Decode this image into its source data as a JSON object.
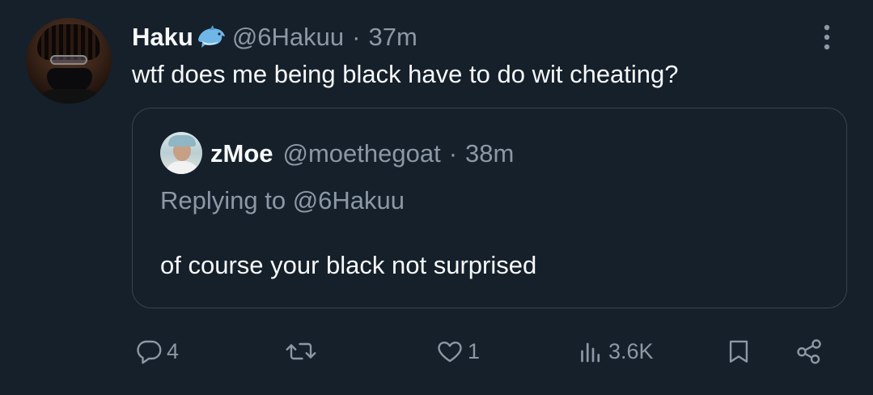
{
  "tweet": {
    "author_name": "Haku",
    "author_handle": "@6Hakuu",
    "separator": "·",
    "time": "37m",
    "text": "wtf does me being black have to do wit cheating?"
  },
  "quote": {
    "author_name": "zMoe",
    "author_handle": "@moethegoat",
    "separator": "·",
    "time": "38m",
    "replying_to": "Replying to @6Hakuu",
    "text": "of course your black not surprised"
  },
  "actions": {
    "replies": "4",
    "retweets": "",
    "likes": "1",
    "views": "3.6K"
  },
  "icons": {
    "badge": "dolphin-emoji",
    "more": "more-vertical-icon",
    "reply": "reply-icon",
    "retweet": "retweet-icon",
    "like": "heart-icon",
    "views": "views-icon",
    "bookmark": "bookmark-icon",
    "share": "share-icon"
  },
  "colors": {
    "background": "#15202b",
    "text": "#f7f9f9",
    "muted": "#8b98a5",
    "border": "#38444d"
  }
}
